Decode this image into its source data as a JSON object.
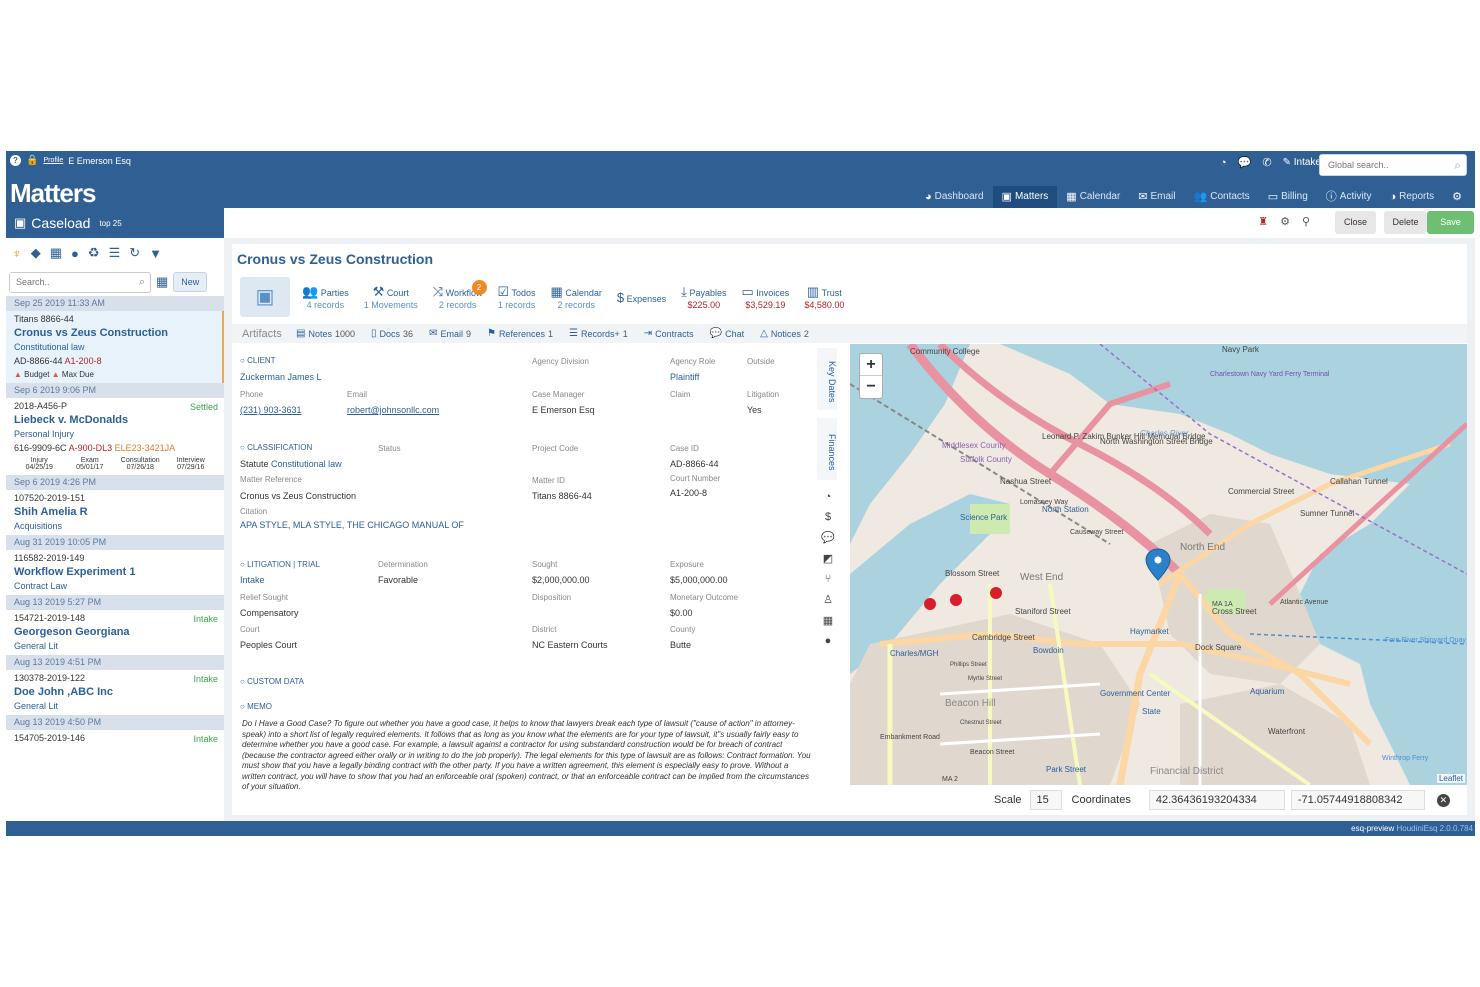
{
  "topbar": {
    "help_icon": "question-circle-icon",
    "profile_link": "Profile",
    "user_name": "E Emerson Esq",
    "brand": "Matters",
    "intake_label": "Intake",
    "global_search_placeholder": "Global search.."
  },
  "nav": {
    "items": [
      {
        "label": "Dashboard",
        "icon": "dashboard-icon"
      },
      {
        "label": "Matters",
        "icon": "briefcase-icon"
      },
      {
        "label": "Calendar",
        "icon": "calendar-icon"
      },
      {
        "label": "Email",
        "icon": "envelope-icon"
      },
      {
        "label": "Contacts",
        "icon": "users-icon"
      },
      {
        "label": "Billing",
        "icon": "money-icon"
      },
      {
        "label": "Activity",
        "icon": "info-icon"
      },
      {
        "label": "Reports",
        "icon": "pie-chart-icon"
      }
    ],
    "active": "Matters"
  },
  "caseload": {
    "title": "Caseload",
    "subtitle": "top 25",
    "search_placeholder": "Search..",
    "new_label": "New"
  },
  "cases": [
    {
      "date": "Sep 25 2019 11:33 AM",
      "num": "Titans 8866-44",
      "status": "",
      "name": "Cronus vs Zeus Construction",
      "type": "Constitutional law",
      "id1": "AD-8866-44",
      "id2": "A1-200-8",
      "id3": "",
      "warn1": "Budget",
      "warn2": "Max Due"
    },
    {
      "date": "Sep 6 2019 9:06 PM",
      "num": "2018-A456-P",
      "status": "Settled",
      "name": "Liebeck v. McDonalds",
      "type": "Personal Injury",
      "id1": "616-9909-6C",
      "id2": "A-900-DL3",
      "id3": "ELE23-3421JA",
      "milestones": [
        {
          "label": "Injury",
          "date": "04/25/19"
        },
        {
          "label": "Exam",
          "date": "05/01/17"
        },
        {
          "label": "Consultation",
          "date": "07/26/18"
        },
        {
          "label": "Interview",
          "date": "07/29/16"
        }
      ]
    },
    {
      "date": "Sep 6 2019 4:26 PM",
      "num": "107520-2019-151",
      "status": "",
      "name": "Shih Amelia R",
      "type": "Acquisitions"
    },
    {
      "date": "Aug 31 2019 10:05 PM",
      "num": "116582-2019-149",
      "status": "",
      "name": "Workflow Experiment 1",
      "type": "Contract Law"
    },
    {
      "date": "Aug 13 2019 5:27 PM",
      "num": "154721-2019-148",
      "status": "Intake",
      "name": "Georgeson Georgiana",
      "type": "General Lit"
    },
    {
      "date": "Aug 13 2019 4:51 PM",
      "num": "130378-2019-122",
      "status": "Intake",
      "name": "Doe John ,ABC Inc",
      "type": "General Lit"
    },
    {
      "date": "Aug 13 2019 4:50 PM",
      "num": "154705-2019-146",
      "status": "Intake",
      "name": "",
      "type": ""
    }
  ],
  "actions": {
    "close": "Close",
    "delete": "Delete",
    "save": "Save"
  },
  "matter": {
    "title": "Cronus vs Zeus Construction",
    "tools": [
      {
        "label": "Parties",
        "count": "4 records",
        "icon": "users-icon"
      },
      {
        "label": "Court",
        "count": "1 Movements",
        "icon": "gavel-icon"
      },
      {
        "label": "Workflow",
        "count": "2 records",
        "icon": "random-icon",
        "badge": "2"
      },
      {
        "label": "Todos",
        "count": "1 records",
        "icon": "check-square-icon"
      },
      {
        "label": "Calendar",
        "count": "2 records",
        "icon": "calendar-icon"
      },
      {
        "label": "Expenses",
        "count": "",
        "icon": "dollar-icon"
      },
      {
        "label": "Payables",
        "count": "$225.00",
        "icon": "download-icon"
      },
      {
        "label": "Invoices",
        "count": "$3,529.19",
        "icon": "money-icon"
      },
      {
        "label": "Trust",
        "count": "$4,580.00",
        "icon": "bank-icon"
      }
    ],
    "artifacts_label": "Artifacts",
    "artifacts": [
      {
        "label": "Notes",
        "count": "1000"
      },
      {
        "label": "Docs",
        "count": "36"
      },
      {
        "label": "Email",
        "count": "9"
      },
      {
        "label": "References",
        "count": "1"
      },
      {
        "label": "Records+",
        "count": "1"
      },
      {
        "label": "Contracts",
        "count": ""
      },
      {
        "label": "Chat",
        "count": ""
      },
      {
        "label": "Notices",
        "count": "2"
      }
    ]
  },
  "client": {
    "section": "CLIENT",
    "name": "Zuckerman James L",
    "phone_label": "Phone",
    "phone": "(231) 903-3631",
    "email_label": "Email",
    "email": "robert@johnsonllc.com",
    "agency_division_label": "Agency Division",
    "agency_role_label": "Agency Role",
    "agency_role": "Plaintiff",
    "outside_label": "Outside",
    "case_manager_label": "Case Manager",
    "case_manager": "E Emerson Esq",
    "claim_label": "Claim",
    "litigation_label": "Litigation",
    "litigation": "Yes"
  },
  "classification": {
    "section": "CLASSIFICATION",
    "status_label": "Status",
    "type_prefix": "Statute",
    "type": "Constitutional law",
    "project_code_label": "Project Code",
    "case_id_label": "Case ID",
    "case_id": "AD-8866-44",
    "matter_ref_label": "Matter Reference",
    "matter_ref": "Cronus vs Zeus Construction",
    "matter_id_label": "Matter ID",
    "matter_id": "Titans 8866-44",
    "court_number_label": "Court Number",
    "court_number": "A1-200-8",
    "citation_label": "Citation",
    "citation": "APA STYLE, MLA STYLE, THE CHICAGO MANUAL OF"
  },
  "litigation": {
    "section": "LITIGATION | TRIAL",
    "stage": "Intake",
    "determination_label": "Determination",
    "determination": "Favorable",
    "sought_label": "Sought",
    "sought": "$2,000,000.00",
    "exposure_label": "Exposure",
    "exposure": "$5,000,000.00",
    "relief_label": "Relief Sought",
    "relief": "Compensatory",
    "disposition_label": "Disposition",
    "monetary_label": "Monetary Outcome",
    "monetary": "$0.00",
    "court_label": "Court",
    "court": "Peoples Court",
    "district_label": "District",
    "district": "NC Eastern Courts",
    "county_label": "County",
    "county": "Butte"
  },
  "custom_data": {
    "section": "CUSTOM DATA"
  },
  "memo": {
    "section": "MEMO",
    "text": "Do I Have a Good Case? To figure out whether you have a good case, it helps to know that lawyers break each type of lawsuit (\"cause of action\" in attorney-speak) into a short list of legally required elements. It follows that as long as you know what the elements are for your type of lawsuit, it\"s usually fairly easy to determine whether you have a good case. For example, a lawsuit against a contractor for using substandard construction would be for breach of contract (because the contractor agreed either orally or in writing to do the job properly). The legal elements for this type of lawsuit are as follows: Contract formation. You must show that you have a legally binding contract with the other party. If you have a written agreement, this element is especially easy to prove. Without a written contract, you will have to show that you had an enforceable oral (spoken) contract, or that an enforceable contract can be implied from the circumstances of your situation."
  },
  "vertical_tabs": {
    "key_dates": "Key Dates",
    "finances": "Finances"
  },
  "map": {
    "labels": [
      "Community College",
      "Charlestown Navy Yard Ferry Terminal",
      "Leonard P. Zakim Bunker Hill Memorial Bridge",
      "North Washington Street Bridge",
      "Charles River",
      "Middlesex County",
      "Suffolk County",
      "Nashua Street",
      "North Station",
      "Science Park",
      "North End",
      "West End",
      "Blossom Street",
      "Cambridge Street",
      "Haymarket",
      "Bowdoin",
      "Charles/MGH",
      "Government Center",
      "State",
      "Aquarium",
      "Beacon Hill",
      "Park Street",
      "Financial District",
      "Waterfront",
      "Commercial Street",
      "Callahan Tunnel",
      "Sumner Tunnel",
      "Cross Street",
      "Dock Square",
      "Navy Park",
      "Staniford Street",
      "MA 1A",
      "MA 2",
      "Embankment Road",
      "Phillips Street",
      "Myrtle Street",
      "Chestnut Street",
      "Beacon Street",
      "Atlantic Avenue",
      "Fore River Shipyard Quay",
      "Winthrop Ferry",
      "Lomasney Way",
      "Causeway Street"
    ],
    "attribution": "Leaflet"
  },
  "coords": {
    "scale_label": "Scale",
    "scale": "15",
    "coordinates_label": "Coordinates",
    "lat": "42.36436193204334",
    "lng": "-71.05744918808342"
  },
  "footer": {
    "env": "esq-preview",
    "product": "HoudiniEsq 2.0.0.784"
  }
}
